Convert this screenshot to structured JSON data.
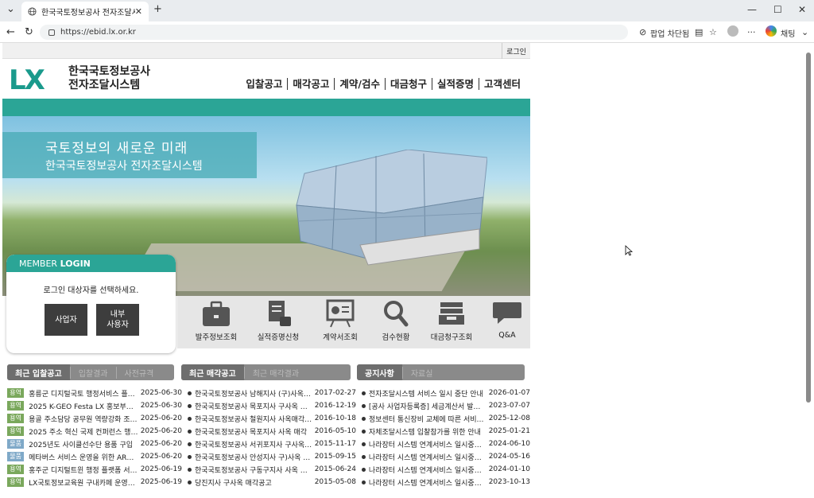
{
  "browser": {
    "tab_title": "한국국토정보공사 전자조달시스템",
    "url": "https://ebid.lx.or.kr",
    "popup_blocked": "팝업 차단됨",
    "chat_label": "채팅"
  },
  "site": {
    "login_link": "로그인",
    "logo_mark": "LX",
    "logo_line1": "한국국토정보공사",
    "logo_line2": "전자조달시스템",
    "gnb": [
      "입찰공고",
      "매각공고",
      "계약/검수",
      "대금청구",
      "실적증명",
      "고객센터"
    ],
    "hero_line1": "국토정보의 새로운 미래",
    "hero_line2": "한국국토정보공사 전자조달시스템"
  },
  "member": {
    "title_a": "MEMBER",
    "title_b": "LOGIN",
    "desc": "로그인 대상자를 선택하세요.",
    "btn_business": "사업자",
    "btn_internal_1": "내부",
    "btn_internal_2": "사용자"
  },
  "quick_links": [
    "발주정보조회",
    "실적증명신청",
    "계약서조회",
    "검수현황",
    "대금청구조회",
    "Q&A"
  ],
  "boards": {
    "bid": {
      "tabs": [
        "최근 입찰공고",
        "입찰결과",
        "사전규격"
      ],
      "rows": [
        {
          "badge": "용역",
          "color": "g",
          "title": "홍릉군 디지털국토 행정서비스 플랫폼...",
          "date": "2025-06-30"
        },
        {
          "badge": "용역",
          "color": "g",
          "title": "2025 K-GEO Festa LX 홍보부스 제작 ...",
          "date": "2025-06-30"
        },
        {
          "badge": "용역",
          "color": "g",
          "title": "용골 주소담당 공무원 역량강화 조정...",
          "date": "2025-06-20"
        },
        {
          "badge": "용역",
          "color": "g",
          "title": "2025 주소 혁신 국제 컨퍼런스 행사대...",
          "date": "2025-06-20"
        },
        {
          "badge": "물품",
          "color": "b",
          "title": "2025년도 사이클선수단 용품 구입",
          "date": "2025-06-20"
        },
        {
          "badge": "물품",
          "color": "b",
          "title": "메타버스 서비스 운영을 위한 AR글래...",
          "date": "2025-06-20"
        },
        {
          "badge": "용역",
          "color": "g",
          "title": "홍주군 디지털트윈 행정 플랫폼 서비...",
          "date": "2025-06-19"
        },
        {
          "badge": "용역",
          "color": "g",
          "title": "LX국토정보교육원 구내카페 운영자 모...",
          "date": "2025-06-19"
        }
      ]
    },
    "sale": {
      "tabs": [
        "최근 매각공고",
        "최근 매각결과"
      ],
      "rows": [
        {
          "title": "한국국토정보공사 남해지사 (구)사옥 매...",
          "date": "2017-02-27"
        },
        {
          "title": "한국국토정보공사 목포지사 구사옥 재...",
          "date": "2016-12-19"
        },
        {
          "title": "한국국토정보공사 철원지사 사옥매각(토...",
          "date": "2016-10-18"
        },
        {
          "title": "한국국토정보공사 목포지사 사옥 매각",
          "date": "2016-05-10"
        },
        {
          "title": "한국국토정보공사 서귀포지사 구사옥 ...",
          "date": "2015-11-17"
        },
        {
          "title": "한국국토정보공사 안성지사 구)사옥 매각",
          "date": "2015-09-15"
        },
        {
          "title": "한국국토정보공사 구동구지사 사옥 매각",
          "date": "2015-06-24"
        },
        {
          "title": "당진지사 구사옥 매각공고",
          "date": "2015-05-08"
        }
      ]
    },
    "notice": {
      "tabs": [
        "공지사항",
        "자료실"
      ],
      "rows": [
        {
          "title": "전자조달시스템 서비스 일시 중단 안내",
          "date": "2026-01-07"
        },
        {
          "title": "[공사 사업자등록증] 세금계산서 발급시...",
          "date": "2023-07-07"
        },
        {
          "title": "정보센터 통신장비 교체에 따른 서비스 ...",
          "date": "2025-12-08"
        },
        {
          "title": "자체조달시스템 입찰참가를 위한 안내",
          "date": "2025-01-21"
        },
        {
          "title": "나라장터 시스템 연계서비스 일시중단 ...",
          "date": "2024-06-10"
        },
        {
          "title": "나라장터 시스템 연계서비스 일시중단 ...",
          "date": "2024-05-16"
        },
        {
          "title": "나라장터 시스템 연계서비스 일시중단 ...",
          "date": "2024-01-10"
        },
        {
          "title": "나라장터 시스템 연계서비스 일시중단 ...",
          "date": "2023-10-13"
        }
      ]
    }
  }
}
